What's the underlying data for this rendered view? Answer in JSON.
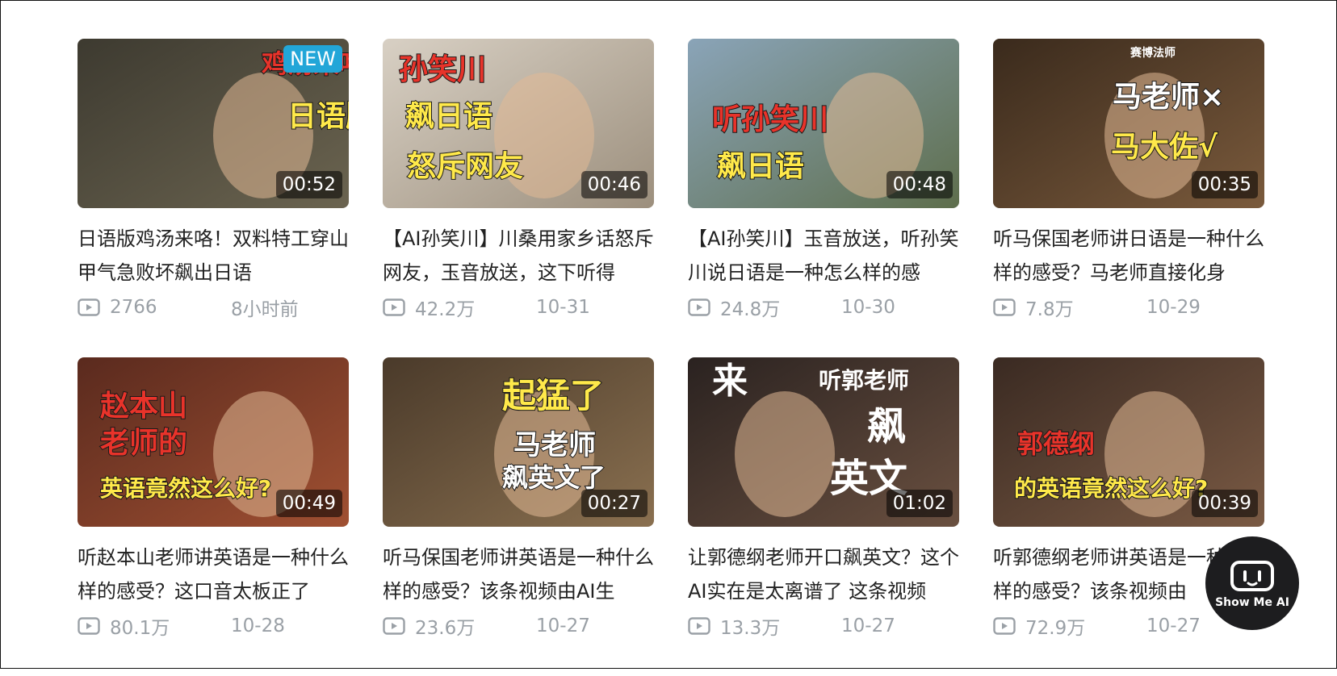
{
  "videos": [
    {
      "title": "日语版鸡汤来咯！双料特工穿山甲气急败坏飙出日语",
      "duration": "00:52",
      "views": "2766",
      "date": "8小时前",
      "badge": "NEW",
      "overlay": [
        "鸡汤来咯",
        "日语版"
      ],
      "palette": [
        "#3d3a30",
        "#6b6450"
      ]
    },
    {
      "title": "【AI孙笑川】川桑用家乡话怒斥网友，玉音放送，这下听得",
      "duration": "00:46",
      "views": "42.2万",
      "date": "10-31",
      "overlay": [
        "孙笑川",
        "飙日语",
        "怒斥网友"
      ],
      "palette": [
        "#d8d0c4",
        "#9c8f7d"
      ]
    },
    {
      "title": "【AI孙笑川】玉音放送，听孙笑川说日语是一种怎么样的感",
      "duration": "00:48",
      "views": "24.8万",
      "date": "10-30",
      "overlay": [
        "听孙笑川",
        "飙日语"
      ],
      "palette": [
        "#8aa4b8",
        "#5e6e4c"
      ]
    },
    {
      "title": "听马保国老师讲日语是一种什么样的感受？马老师直接化身",
      "duration": "00:35",
      "views": "7.8万",
      "date": "10-29",
      "overlay": [
        "马老师×",
        "马大佐√",
        "赛博法师"
      ],
      "palette": [
        "#3a2a1c",
        "#7a5a3c"
      ]
    },
    {
      "title": "听赵本山老师讲英语是一种什么样的感受？这口音太板正了",
      "duration": "00:49",
      "views": "80.1万",
      "date": "10-28",
      "overlay": [
        "赵本山",
        "老师的",
        "英语竟然这么好?"
      ],
      "palette": [
        "#5a2a1e",
        "#a05032"
      ]
    },
    {
      "title": "听马保国老师讲英语是一种什么样的感受？该条视频由AI生",
      "duration": "00:27",
      "views": "23.6万",
      "date": "10-27",
      "overlay": [
        "起猛了",
        "马老师",
        "飙英文了"
      ],
      "palette": [
        "#4a3a2a",
        "#8a7050"
      ]
    },
    {
      "title": "让郭德纲老师开口飙英文？这个AI实在是太离谱了 这条视频",
      "duration": "01:02",
      "views": "13.3万",
      "date": "10-27",
      "overlay": [
        "来",
        "听郭老师",
        "飙",
        "英文"
      ],
      "palette": [
        "#2a2220",
        "#6a5040"
      ]
    },
    {
      "title": "听郭德纲老师讲英语是一种什么样的感受？该条视频由",
      "duration": "00:39",
      "views": "72.9万",
      "date": "10-27",
      "overlay": [
        "郭德纲",
        "的英语竟然这么好?"
      ],
      "palette": [
        "#3a2a22",
        "#7a5a44"
      ]
    }
  ],
  "assistant": {
    "label": "Show Me AI"
  },
  "colors": {
    "yellow_text": "#ffe94a",
    "red_text": "#e8332a",
    "meta_gray": "#9aa0a6"
  }
}
